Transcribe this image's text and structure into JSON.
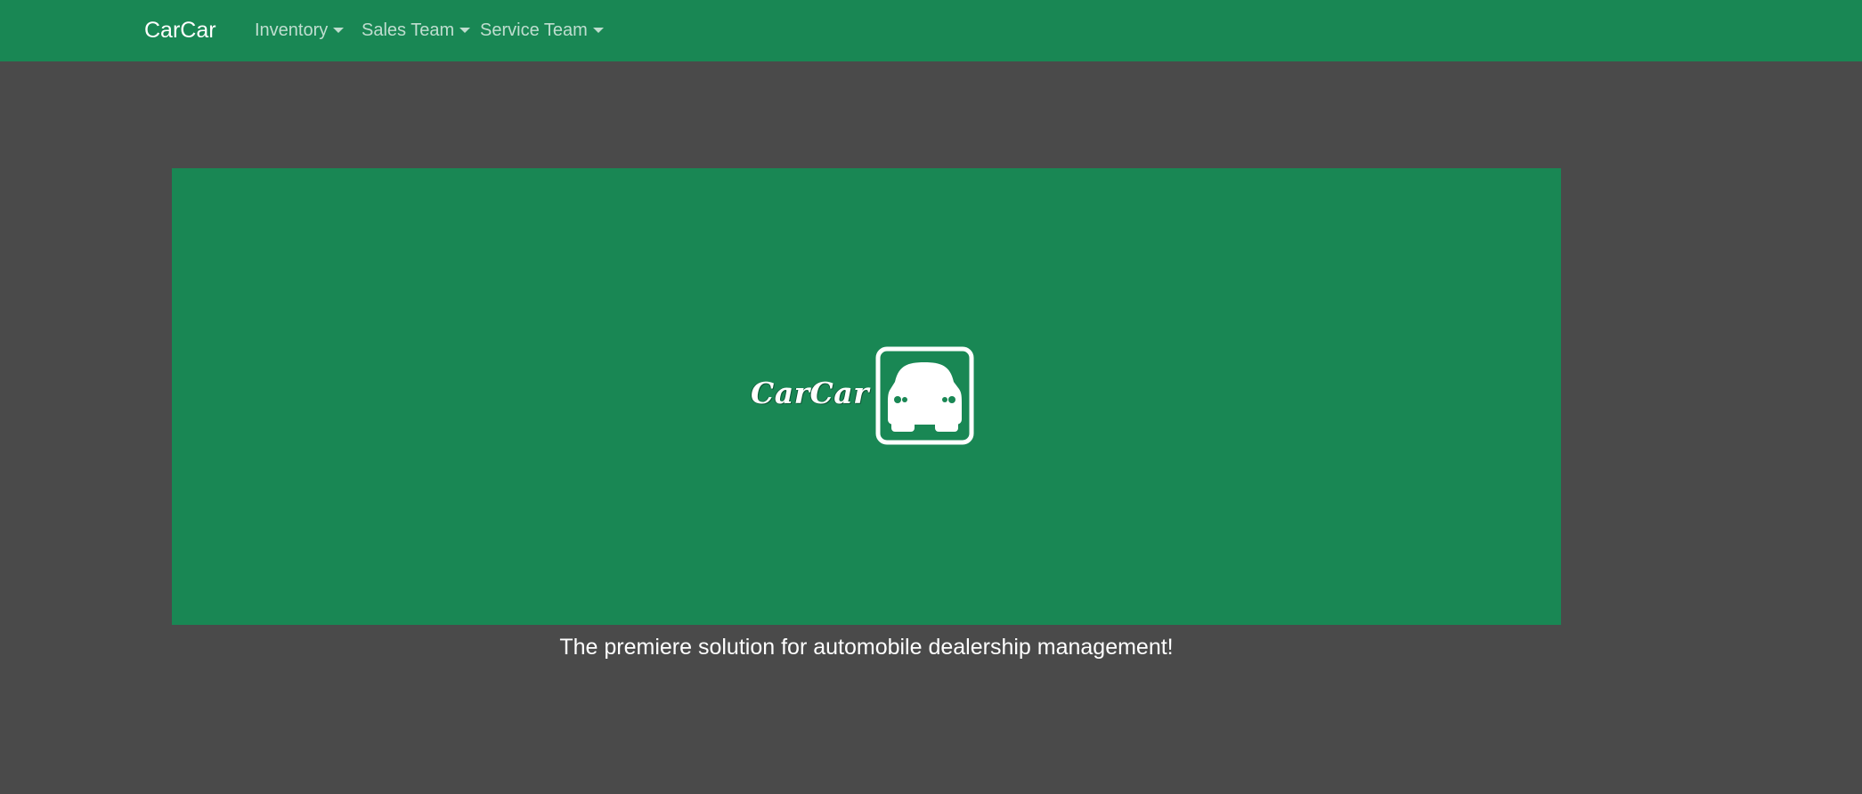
{
  "navbar": {
    "brand": "CarCar",
    "items": [
      {
        "label": "Inventory"
      },
      {
        "label": "Sales Team"
      },
      {
        "label": "Service Team"
      }
    ],
    "background_color": "#198754"
  },
  "hero": {
    "logo_text": "CarCar",
    "logo_icon": "car-front-icon",
    "tagline": "The premiere solution for automobile dealership management!",
    "background_color": "#198754"
  },
  "page": {
    "background_color": "#4a4a4a"
  }
}
